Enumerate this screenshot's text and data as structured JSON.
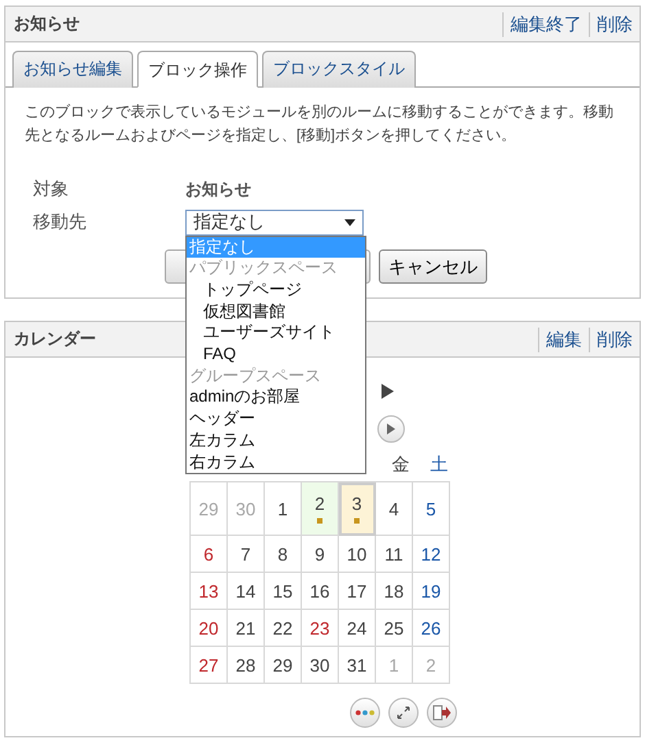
{
  "notice_panel": {
    "title": "お知らせ",
    "actions": [
      "編集終了",
      "削除"
    ],
    "tabs": [
      {
        "label": "お知らせ編集",
        "selected": false
      },
      {
        "label": "ブロック操作",
        "selected": true
      },
      {
        "label": "ブロックスタイル",
        "selected": false
      }
    ],
    "description": "このブロックで表示しているモジュールを別のルームに移動することができます。移動先となるルームおよびページを指定し、[移動]ボタンを押してください。",
    "target": {
      "label": "対象",
      "value": "お知らせ"
    },
    "destination": {
      "label": "移動先",
      "value": "指定なし",
      "expanded": true,
      "options": [
        {
          "label": "指定なし",
          "selected": true,
          "disabled": false
        },
        {
          "label": "パブリックスペース",
          "selected": false,
          "disabled": true,
          "children": [
            {
              "label": "トップページ",
              "selected": false,
              "disabled": false
            },
            {
              "label": "仮想図書館",
              "selected": false,
              "disabled": false
            },
            {
              "label": "ユーザーズサイト",
              "selected": false,
              "disabled": false
            },
            {
              "label": "FAQ",
              "selected": false,
              "disabled": false
            }
          ]
        },
        {
          "label": "グループスペース",
          "selected": false,
          "disabled": true
        },
        {
          "label": "adminのお部屋",
          "selected": false,
          "disabled": false
        },
        {
          "label": "ヘッダー",
          "selected": false,
          "disabled": false
        },
        {
          "label": "左カラム",
          "selected": false,
          "disabled": false
        },
        {
          "label": "右カラム",
          "selected": false,
          "disabled": false
        }
      ]
    },
    "cancel_button": "キャンセル"
  },
  "calendar_panel": {
    "title": "カレンダー",
    "actions": [
      "編集",
      "削除"
    ],
    "weekdays": [
      {
        "label": "金",
        "kind": "weekday"
      },
      {
        "label": "土",
        "kind": "saturday"
      }
    ],
    "days": [
      {
        "day": "29",
        "kind": "other",
        "today": false,
        "selected": false,
        "event": false
      },
      {
        "day": "30",
        "kind": "other",
        "today": false,
        "selected": false,
        "event": false
      },
      {
        "day": "1",
        "kind": "weekday",
        "today": false,
        "selected": false,
        "event": false
      },
      {
        "day": "2",
        "kind": "weekday",
        "today": false,
        "selected": true,
        "event": true
      },
      {
        "day": "3",
        "kind": "weekday",
        "today": true,
        "selected": false,
        "event": true
      },
      {
        "day": "4",
        "kind": "weekday",
        "today": false,
        "selected": false,
        "event": false
      },
      {
        "day": "5",
        "kind": "saturday",
        "today": false,
        "selected": false,
        "event": false
      },
      {
        "day": "6",
        "kind": "sunday",
        "today": false,
        "selected": false,
        "event": false
      },
      {
        "day": "7",
        "kind": "weekday",
        "today": false,
        "selected": false,
        "event": false
      },
      {
        "day": "8",
        "kind": "weekday",
        "today": false,
        "selected": false,
        "event": false
      },
      {
        "day": "9",
        "kind": "weekday",
        "today": false,
        "selected": false,
        "event": false
      },
      {
        "day": "10",
        "kind": "weekday",
        "today": false,
        "selected": false,
        "event": false
      },
      {
        "day": "11",
        "kind": "weekday",
        "today": false,
        "selected": false,
        "event": false
      },
      {
        "day": "12",
        "kind": "saturday",
        "today": false,
        "selected": false,
        "event": false
      },
      {
        "day": "13",
        "kind": "sunday",
        "today": false,
        "selected": false,
        "event": false
      },
      {
        "day": "14",
        "kind": "weekday",
        "today": false,
        "selected": false,
        "event": false
      },
      {
        "day": "15",
        "kind": "weekday",
        "today": false,
        "selected": false,
        "event": false
      },
      {
        "day": "16",
        "kind": "weekday",
        "today": false,
        "selected": false,
        "event": false
      },
      {
        "day": "17",
        "kind": "weekday",
        "today": false,
        "selected": false,
        "event": false
      },
      {
        "day": "18",
        "kind": "weekday",
        "today": false,
        "selected": false,
        "event": false
      },
      {
        "day": "19",
        "kind": "saturday",
        "today": false,
        "selected": false,
        "event": false
      },
      {
        "day": "20",
        "kind": "sunday",
        "today": false,
        "selected": false,
        "event": false
      },
      {
        "day": "21",
        "kind": "weekday",
        "today": false,
        "selected": false,
        "event": false
      },
      {
        "day": "22",
        "kind": "weekday",
        "today": false,
        "selected": false,
        "event": false
      },
      {
        "day": "23",
        "kind": "holiday",
        "today": false,
        "selected": false,
        "event": false
      },
      {
        "day": "24",
        "kind": "weekday",
        "today": false,
        "selected": false,
        "event": false
      },
      {
        "day": "25",
        "kind": "weekday",
        "today": false,
        "selected": false,
        "event": false
      },
      {
        "day": "26",
        "kind": "saturday",
        "today": false,
        "selected": false,
        "event": false
      },
      {
        "day": "27",
        "kind": "sunday",
        "today": false,
        "selected": false,
        "event": false
      },
      {
        "day": "28",
        "kind": "weekday",
        "today": false,
        "selected": false,
        "event": false
      },
      {
        "day": "29",
        "kind": "weekday",
        "today": false,
        "selected": false,
        "event": false
      },
      {
        "day": "30",
        "kind": "weekday",
        "today": false,
        "selected": false,
        "event": false
      },
      {
        "day": "31",
        "kind": "weekday",
        "today": false,
        "selected": false,
        "event": false
      },
      {
        "day": "1",
        "kind": "other",
        "today": false,
        "selected": false,
        "event": false
      },
      {
        "day": "2",
        "kind": "other",
        "today": false,
        "selected": false,
        "event": false
      }
    ]
  }
}
